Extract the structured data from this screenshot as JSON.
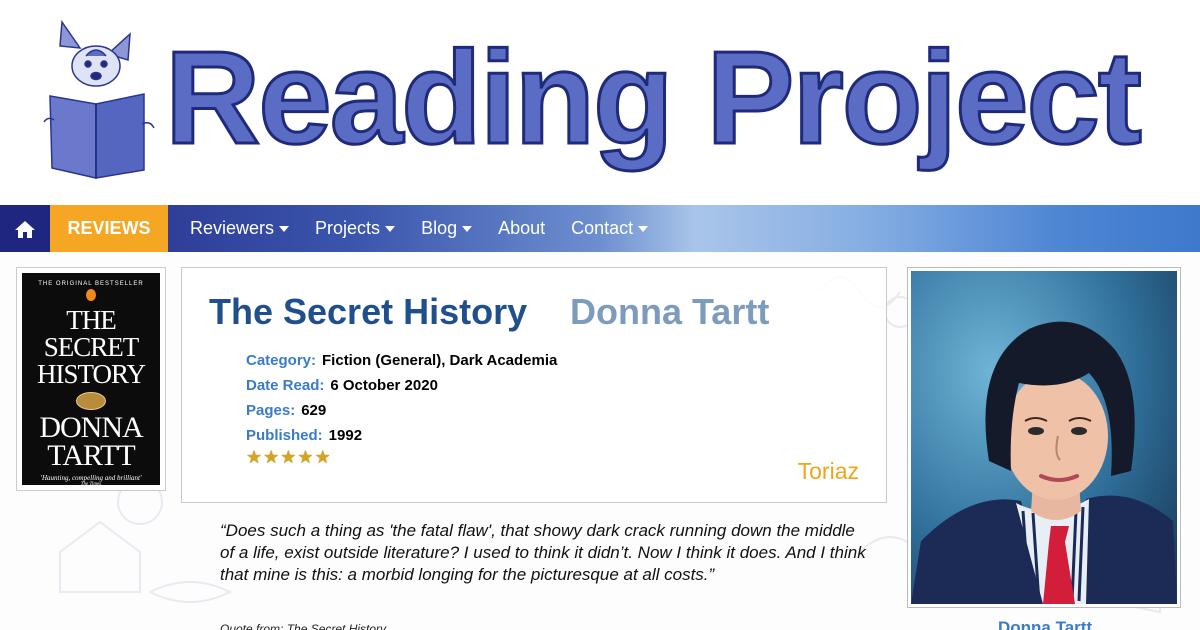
{
  "header": {
    "site_title": "Reading Project",
    "logo_icon": "dog-reading-book-logo"
  },
  "nav": {
    "home_icon": "home-icon",
    "items": [
      {
        "label": "REVIEWS",
        "active": true
      },
      {
        "label": "Reviewers",
        "dropdown": true
      },
      {
        "label": "Projects",
        "dropdown": true
      },
      {
        "label": "Blog",
        "dropdown": true
      },
      {
        "label": "About",
        "dropdown": false
      },
      {
        "label": "Contact",
        "dropdown": true
      }
    ],
    "active_color": "#f5a623"
  },
  "book": {
    "title": "The Secret History",
    "author": "Donna Tartt",
    "category_label": "Category:",
    "category": "Fiction (General), Dark Academia",
    "date_read_label": "Date Read:",
    "date_read": "6 October 2020",
    "pages_label": "Pages:",
    "pages": "629",
    "published_label": "Published:",
    "published": "1992",
    "rating": 5,
    "rating_max": 5,
    "reviewer": "Toriaz"
  },
  "cover": {
    "tagline": "THE ORIGINAL BESTSELLER",
    "title_line1": "THE",
    "title_line2": "SECRET",
    "title_line3": "HISTORY",
    "author_line1": "DONNA",
    "author_line2": "TARTT",
    "blurb": "'Haunting, compelling and brilliant'",
    "blurb_source": "The Times"
  },
  "quote": {
    "text": "“Does such a thing as 'the fatal flaw', that showy dark crack running down the middle of a life, exist outside literature? I used to think it didn’t. Now I think it does. And I think that mine is this: a morbid longing for the picturesque at all costs.”",
    "source": "Quote from: The Secret History"
  },
  "author_photo": {
    "caption": "Donna Tartt"
  },
  "colors": {
    "title_blue": "#1f4f8c",
    "author_grey_blue": "#7c9bbd",
    "label_blue": "#3a7bc8",
    "reviewer_orange": "#f0a41a"
  }
}
